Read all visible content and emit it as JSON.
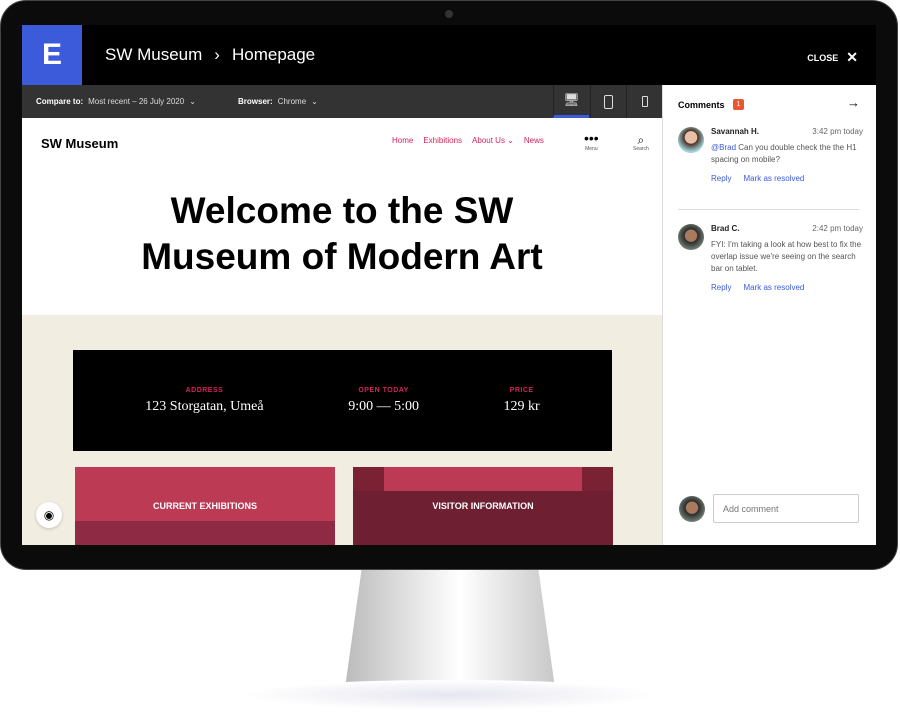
{
  "app": {
    "logo": "E",
    "site": "SW Museum",
    "separator": "›",
    "page": "Homepage",
    "close": "CLOSE"
  },
  "toolbar": {
    "compare_label": "Compare to:",
    "compare_value": "Most recent – 26 July 2020",
    "browser_label": "Browser:",
    "browser_value": "Chrome",
    "devices": [
      "desktop",
      "tablet",
      "mobile"
    ],
    "active_device": "desktop"
  },
  "site": {
    "title": "SW Museum",
    "nav": [
      "Home",
      "Exhibitions",
      "About Us",
      "News"
    ],
    "menu": "Menu",
    "search": "Search",
    "heading_line1": "Welcome to the SW",
    "heading_line2": "Museum of Modern Art",
    "info": [
      {
        "label": "ADDRESS",
        "value": "123 Storgatan, Umeå"
      },
      {
        "label": "OPEN TODAY",
        "value": "9:00 — 5:00"
      },
      {
        "label": "PRICE",
        "value": "129 kr"
      }
    ],
    "cards": [
      "CURRENT EXHIBITIONS",
      "VISITOR INFORMATION"
    ]
  },
  "comments": {
    "title": "Comments",
    "count": "1",
    "items": [
      {
        "author": "Savannah H.",
        "time": "3:42 pm today",
        "mention": "@Brad",
        "text": "Can you double check the the H1 spacing on mobile?",
        "reply": "Reply",
        "resolve": "Mark as resolved"
      },
      {
        "author": "Brad C.",
        "time": "2:42 pm today",
        "mention": "",
        "text": "FYI: I'm taking a look at how best to fix the overlap issue we're seeing on the search bar on tablet.",
        "reply": "Reply",
        "resolve": "Mark as resolved"
      }
    ],
    "add_placeholder": "Add comment"
  },
  "colors": {
    "accent": "#3b5bdb",
    "brand_pink": "#d6225a",
    "badge": "#e8572f",
    "cream": "#f1ede0"
  }
}
